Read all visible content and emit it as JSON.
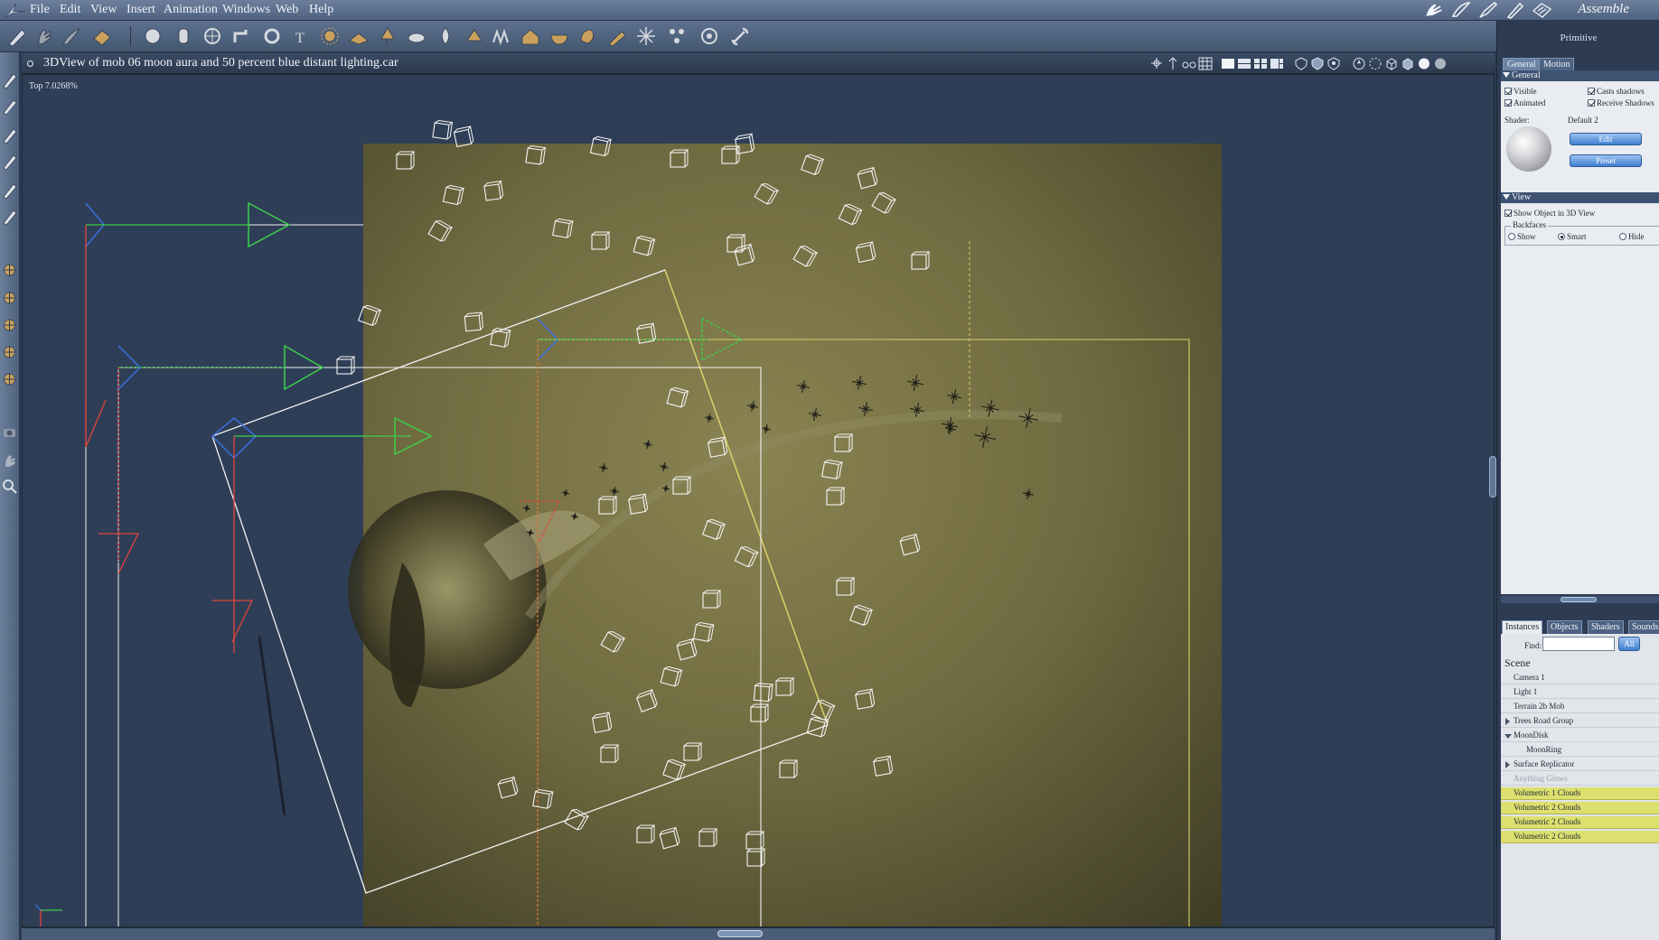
{
  "menubar": {
    "items": [
      "File",
      "Edit",
      "View",
      "Insert",
      "Animation",
      "Windows",
      "Web",
      "Help"
    ],
    "mode": "Assemble"
  },
  "view": {
    "title": "3DView of mob 06 moon aura and 50 percent blue distant lighting.car",
    "zoom": "Top 7.0268%"
  },
  "panel": {
    "title": "Primitive",
    "tabs": [
      "General",
      "Motion"
    ],
    "general_section": "General",
    "checkboxes": {
      "visible": "Visible",
      "casts_shadows": "Casts shadows",
      "animated": "Animated",
      "receive_shadows": "Receive Shadows"
    },
    "shader_label": "Shader:",
    "shader_value": "Default 2",
    "edit_button": "Edit",
    "preset_button": "Preset",
    "view_section": "View",
    "show_object": "Show Object in 3D View",
    "backfaces_label": "Backfaces",
    "backfaces_options": [
      "Show",
      "Smart",
      "Hide"
    ],
    "backfaces_selected": "Smart"
  },
  "browser": {
    "tabs": [
      "Instances",
      "Objects",
      "Shaders",
      "Sounds"
    ],
    "find_label": "Find:",
    "find_value": "",
    "all_button": "All",
    "scene_label": "Scene",
    "rows": [
      {
        "label": "Camera 1",
        "state": "normal",
        "expander": "none",
        "indent": 0
      },
      {
        "label": "Light 1",
        "state": "normal",
        "expander": "none",
        "indent": 0
      },
      {
        "label": "Terrain 2b Mob",
        "state": "normal",
        "expander": "none",
        "indent": 0
      },
      {
        "label": "Trees Road Group",
        "state": "normal",
        "expander": "closed",
        "indent": 0
      },
      {
        "label": "MoonDisk",
        "state": "normal",
        "expander": "open",
        "indent": 0
      },
      {
        "label": "MoonRing",
        "state": "normal",
        "expander": "none",
        "indent": 1
      },
      {
        "label": "Surface Replicator",
        "state": "normal",
        "expander": "closed",
        "indent": 0
      },
      {
        "label": "Anything Glows",
        "state": "dim",
        "expander": "none",
        "indent": 0
      },
      {
        "label": "Volumetric 1 Clouds",
        "state": "highlight",
        "expander": "none",
        "indent": 0
      },
      {
        "label": "Volumetric 2 Clouds",
        "state": "highlight",
        "expander": "none",
        "indent": 0
      },
      {
        "label": "Volumetric 2 Clouds",
        "state": "highlight",
        "expander": "none",
        "indent": 0
      },
      {
        "label": "Volumetric 2 Clouds",
        "state": "highlight",
        "expander": "none",
        "indent": 0
      }
    ]
  },
  "colors": {
    "terrain": "#7a7446",
    "viewport_bg": "#2f3e57",
    "highlight_row": "#dddf6e",
    "axis_red": "#e0443c",
    "axis_green": "#3ccf4a",
    "axis_blue": "#3a6fe0"
  },
  "toolbar_icons": [
    "pen-icon",
    "hand-icon",
    "brush-icon",
    "render-icon",
    "sphere-icon",
    "cylinder-icon",
    "globe-icon",
    "pipe-icon",
    "torus-icon",
    "text-icon",
    "metaball-icon",
    "terrain-icon",
    "tree-icon",
    "cloud-icon",
    "fire-icon",
    "plant-icon",
    "grass-icon",
    "house-icon",
    "bowl-icon",
    "rock-icon",
    "brush2-icon",
    "sparkle-icon",
    "gear-group-icon",
    "target-icon",
    "bone-icon"
  ]
}
